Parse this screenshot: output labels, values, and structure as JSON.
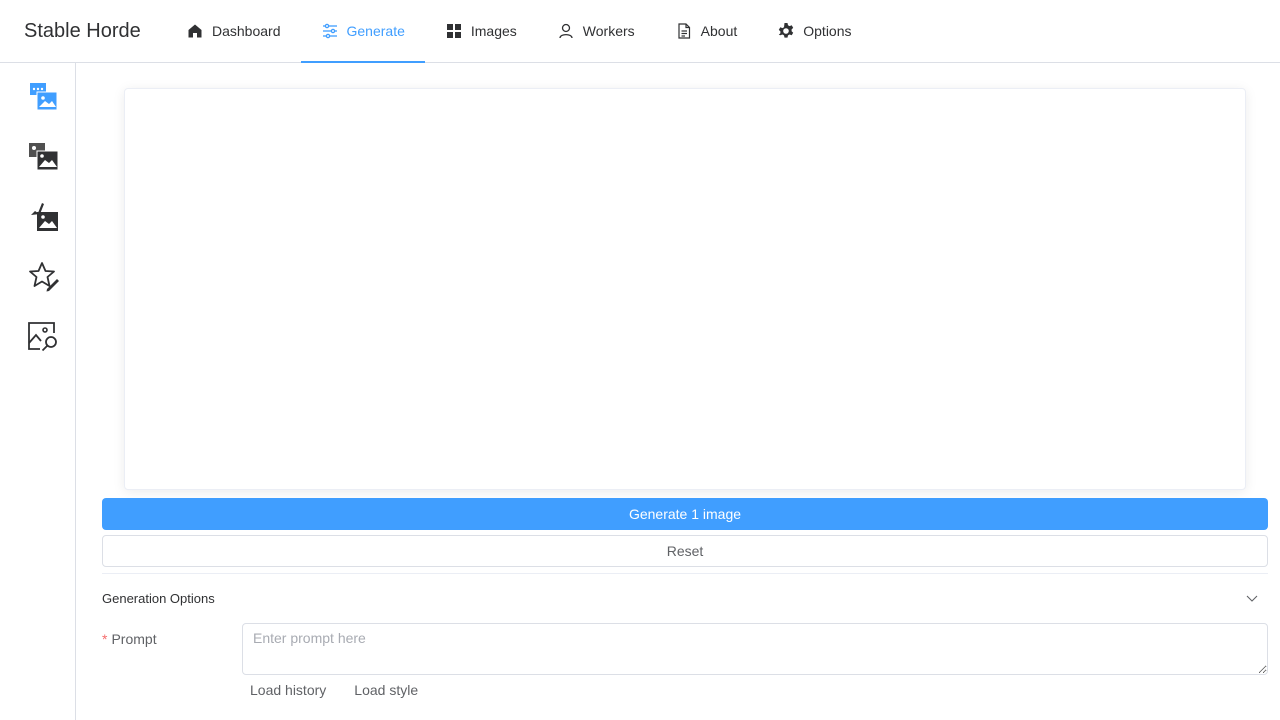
{
  "brand": "Stable Horde",
  "nav": {
    "items": [
      {
        "label": "Dashboard",
        "icon": "home-icon",
        "active": false
      },
      {
        "label": "Generate",
        "icon": "sliders-icon",
        "active": true
      },
      {
        "label": "Images",
        "icon": "grid-icon",
        "active": false
      },
      {
        "label": "Workers",
        "icon": "user-icon",
        "active": false
      },
      {
        "label": "About",
        "icon": "document-icon",
        "active": false
      },
      {
        "label": "Options",
        "icon": "gear-icon",
        "active": false
      }
    ]
  },
  "sidebar": {
    "items": [
      {
        "name": "text2img",
        "icon": "text-to-image-icon",
        "active": true
      },
      {
        "name": "img2img",
        "icon": "image-to-image-icon",
        "active": false
      },
      {
        "name": "inpainting",
        "icon": "inpaint-icon",
        "active": false
      },
      {
        "name": "rating",
        "icon": "star-edit-icon",
        "active": false
      },
      {
        "name": "interrogation",
        "icon": "image-search-icon",
        "active": false
      }
    ]
  },
  "actions": {
    "generate_label": "Generate 1 image",
    "reset_label": "Reset"
  },
  "options": {
    "section_title": "Generation Options",
    "prompt_label": "Prompt",
    "prompt_required_mark": "*",
    "prompt_value": "",
    "prompt_placeholder": "Enter prompt here",
    "load_history_label": "Load history",
    "load_style_label": "Load style"
  },
  "colors": {
    "accent": "#409eff",
    "required": "#f56c6c",
    "text": "#303133"
  }
}
